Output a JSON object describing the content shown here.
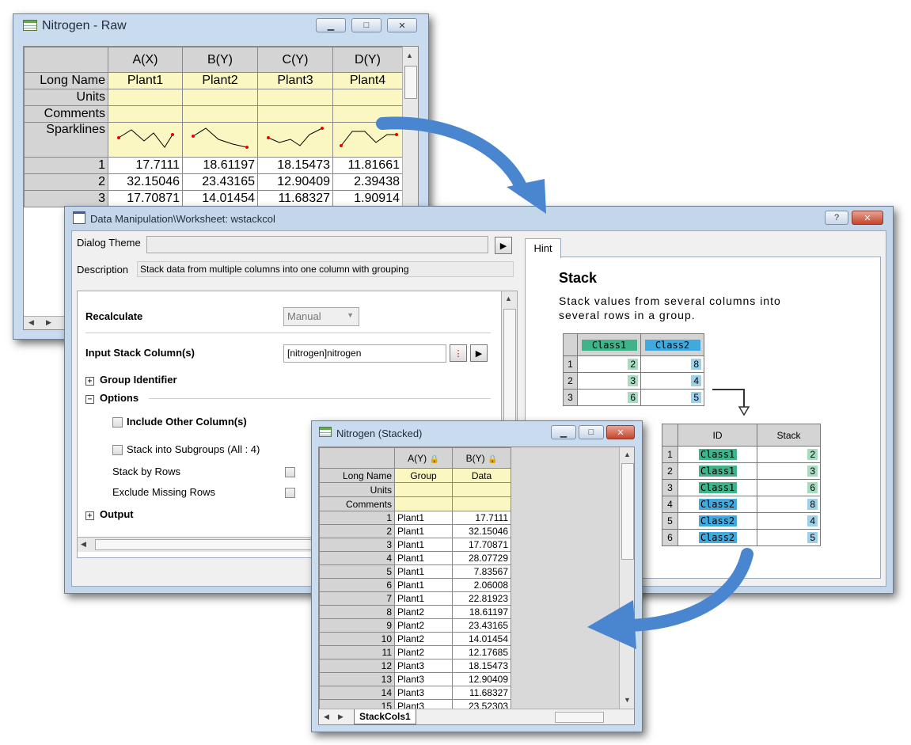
{
  "raw": {
    "title": "Nitrogen - Raw",
    "columns": [
      "A(X)",
      "B(Y)",
      "C(Y)",
      "D(Y)"
    ],
    "row_labels": {
      "long_name": "Long Name",
      "units": "Units",
      "comments": "Comments",
      "sparklines": "Sparklines"
    },
    "long_names": [
      "Plant1",
      "Plant2",
      "Plant3",
      "Plant4"
    ],
    "rows": [
      {
        "n": "1",
        "v": [
          "17.7111",
          "18.61197",
          "18.15473",
          "11.81661"
        ]
      },
      {
        "n": "2",
        "v": [
          "32.15046",
          "23.43165",
          "12.90409",
          "2.39438"
        ]
      },
      {
        "n": "3",
        "v": [
          "17.70871",
          "14.01454",
          "11.68327",
          "1.90914"
        ]
      }
    ]
  },
  "dialog": {
    "title": "Data Manipulation\\Worksheet: wstackcol",
    "dialog_theme_label": "Dialog Theme",
    "description_label": "Description",
    "description": "Stack data from multiple columns into one column with grouping",
    "recalculate_label": "Recalculate",
    "recalculate_value": "Manual",
    "input_label": "Input Stack Column(s)",
    "input_value": "[nitrogen]nitrogen",
    "group_identifier": "Group Identifier",
    "options": "Options",
    "include_other": "Include Other Column(s)",
    "stack_subgroups": "Stack into Subgroups (All : 4)",
    "stack_by_rows": "Stack by Rows",
    "exclude_missing": "Exclude Missing Rows",
    "output": "Output",
    "hint_tab": "Hint",
    "hint_title": "Stack",
    "hint_desc": "Stack values from several columns into several rows in a group.",
    "hint_src": {
      "headers": [
        "Class1",
        "Class2"
      ],
      "rows": [
        [
          "1",
          "2",
          "8"
        ],
        [
          "2",
          "3",
          "4"
        ],
        [
          "3",
          "6",
          "5"
        ]
      ]
    },
    "hint_dst": {
      "headers": [
        "ID",
        "Stack"
      ],
      "rows": [
        [
          "1",
          "Class1",
          "2"
        ],
        [
          "2",
          "Class1",
          "3"
        ],
        [
          "3",
          "Class1",
          "6"
        ],
        [
          "4",
          "Class2",
          "8"
        ],
        [
          "5",
          "Class2",
          "4"
        ],
        [
          "6",
          "Class2",
          "5"
        ]
      ]
    }
  },
  "stacked": {
    "title": "Nitrogen (Stacked)",
    "columns": [
      "A(Y)",
      "B(Y)"
    ],
    "row_labels": {
      "long_name": "Long Name",
      "units": "Units",
      "comments": "Comments"
    },
    "long_names": [
      "Group",
      "Data"
    ],
    "rows": [
      [
        "1",
        "Plant1",
        "17.7111"
      ],
      [
        "2",
        "Plant1",
        "32.15046"
      ],
      [
        "3",
        "Plant1",
        "17.70871"
      ],
      [
        "4",
        "Plant1",
        "28.07729"
      ],
      [
        "5",
        "Plant1",
        "7.83567"
      ],
      [
        "6",
        "Plant1",
        "2.06008"
      ],
      [
        "7",
        "Plant1",
        "22.81923"
      ],
      [
        "8",
        "Plant2",
        "18.61197"
      ],
      [
        "9",
        "Plant2",
        "23.43165"
      ],
      [
        "10",
        "Plant2",
        "14.01454"
      ],
      [
        "11",
        "Plant2",
        "12.17685"
      ],
      [
        "12",
        "Plant3",
        "18.15473"
      ],
      [
        "13",
        "Plant3",
        "12.90409"
      ],
      [
        "14",
        "Plant3",
        "11.68327"
      ],
      [
        "15",
        "Plant3",
        "23.52303"
      ]
    ],
    "sheet_tab": "StackCols1"
  },
  "colors": {
    "accent_arrow": "#4a86cf",
    "class1": "#41b38a",
    "class2": "#40aadf",
    "cell_yellow": "#fbf7c2"
  }
}
